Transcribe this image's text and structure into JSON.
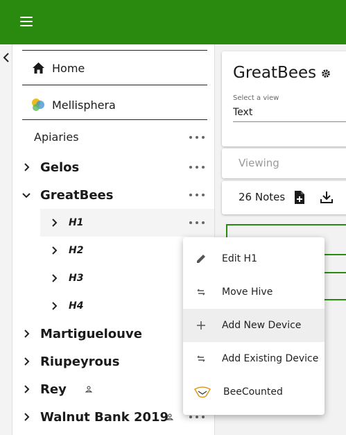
{
  "topbar": {
    "color": "#2a8a0f",
    "menu_icon": "hamburger-icon"
  },
  "sidebar": {
    "nav": [
      {
        "label": "Home",
        "icon": "home-icon"
      },
      {
        "label": "Mellisphera",
        "icon": "mellisphera-logo-icon"
      }
    ],
    "section_title": "Apiaries",
    "apiaries": [
      {
        "label": "Gelos",
        "expanded": false
      },
      {
        "label": "GreatBees",
        "expanded": true,
        "hives": [
          "H1",
          "H2",
          "H3",
          "H4"
        ]
      },
      {
        "label": "Martiguelouve",
        "expanded": false
      },
      {
        "label": "Riupeyrous",
        "expanded": false
      },
      {
        "label": "Rey",
        "expanded": false,
        "shared": true
      },
      {
        "label": "Walnut Bank 2019",
        "expanded": false,
        "shared": true
      }
    ]
  },
  "main": {
    "title": "GreatBees",
    "view_select": {
      "label": "Select a view",
      "value": "Text"
    },
    "viewing_label": "Viewing",
    "notes_label": "26 Notes"
  },
  "context_menu": {
    "items": [
      {
        "label": "Edit H1",
        "icon": "pencil-icon"
      },
      {
        "label": "Move Hive",
        "icon": "swap-arrows-icon"
      },
      {
        "label": "Add New Device",
        "icon": "plus-icon"
      },
      {
        "label": "Add Existing Device",
        "icon": "swap-arrows-icon"
      },
      {
        "label": "BeeCounted",
        "icon": "beecounted-logo-icon"
      }
    ]
  }
}
